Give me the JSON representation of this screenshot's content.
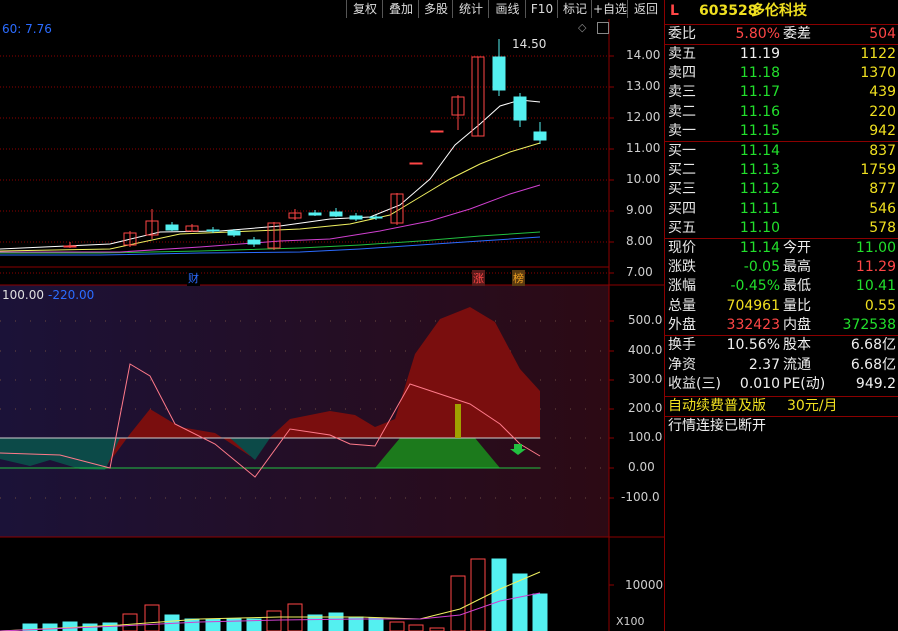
{
  "toolbar": {
    "buttons": [
      "复权",
      "叠加",
      "多股",
      "统计",
      "画线",
      "F10",
      "标记",
      "+自选",
      "返回"
    ]
  },
  "main_chart": {
    "ma_label": "60: 7.76",
    "high_label": "14.50",
    "y_ticks": [
      "14.00",
      "13.00",
      "12.00",
      "11.00",
      "10.00",
      "9.00",
      "8.00",
      "7.00"
    ],
    "markers": [
      "财",
      "涨",
      "榜"
    ]
  },
  "indicator": {
    "label_left": "100.00",
    "label_right": "-220.00",
    "y_ticks": [
      "500.0",
      "400.0",
      "300.0",
      "200.0",
      "100.0",
      "0.00",
      "-100.0"
    ]
  },
  "volume": {
    "y_tick": "10000",
    "unit": "X100"
  },
  "quote": {
    "market_tag": "L",
    "code": "603528",
    "name": "多伦科技",
    "weibi_label": "委比",
    "weibi_value": "5.80%",
    "weicha_label": "委差",
    "weicha_value": "504",
    "asks": [
      {
        "label": "卖五",
        "price": "11.19",
        "vol": "1122"
      },
      {
        "label": "卖四",
        "price": "11.18",
        "vol": "1370"
      },
      {
        "label": "卖三",
        "price": "11.17",
        "vol": "439"
      },
      {
        "label": "卖二",
        "price": "11.16",
        "vol": "220"
      },
      {
        "label": "卖一",
        "price": "11.15",
        "vol": "942"
      }
    ],
    "bids": [
      {
        "label": "买一",
        "price": "11.14",
        "vol": "837"
      },
      {
        "label": "买二",
        "price": "11.13",
        "vol": "1759"
      },
      {
        "label": "买三",
        "price": "11.12",
        "vol": "877"
      },
      {
        "label": "买四",
        "price": "11.11",
        "vol": "546"
      },
      {
        "label": "买五",
        "price": "11.10",
        "vol": "578"
      }
    ],
    "stats1": [
      {
        "l1": "现价",
        "v1": "11.14",
        "c1": "green",
        "l2": "今开",
        "v2": "11.00",
        "c2": "green"
      },
      {
        "l1": "涨跌",
        "v1": "-0.05",
        "c1": "green",
        "l2": "最高",
        "v2": "11.29",
        "c2": "red"
      },
      {
        "l1": "涨幅",
        "v1": "-0.45%",
        "c1": "green",
        "l2": "最低",
        "v2": "10.41",
        "c2": "green"
      },
      {
        "l1": "总量",
        "v1": "704961",
        "c1": "yellow",
        "l2": "量比",
        "v2": "0.55",
        "c2": "yellow"
      },
      {
        "l1": "外盘",
        "v1": "332423",
        "c1": "red",
        "l2": "内盘",
        "v2": "372538",
        "c2": "green"
      }
    ],
    "stats2": [
      {
        "l1": "换手",
        "v1": "10.56%",
        "c1": "white",
        "l2": "股本",
        "v2": "6.68亿",
        "c2": "white"
      },
      {
        "l1": "净资",
        "v1": "2.37",
        "c1": "white",
        "l2": "流通",
        "v2": "6.68亿",
        "c2": "white"
      },
      {
        "l1": "收益(三)",
        "v1": "0.010",
        "c1": "white",
        "l2": "PE(动)",
        "v2": "949.2",
        "c2": "white"
      }
    ],
    "promo_text": "自动续费普及版",
    "promo_price": "30元/月",
    "status": "行情连接已断开"
  }
}
